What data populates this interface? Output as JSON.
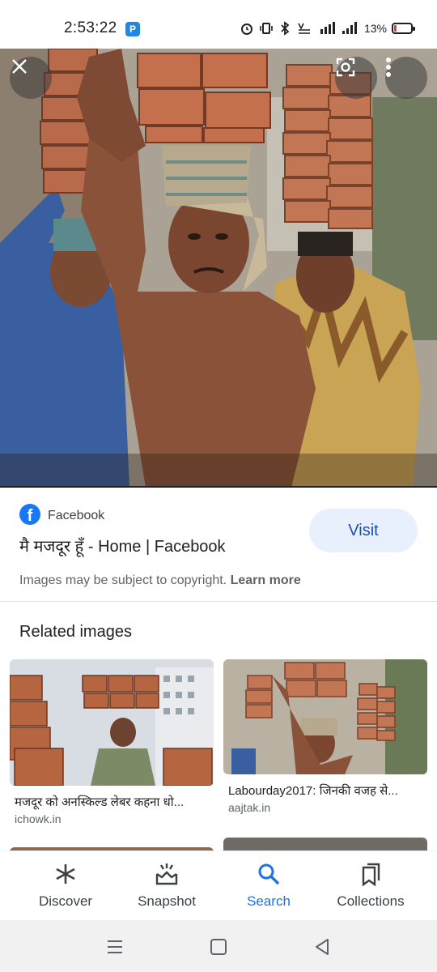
{
  "status_bar": {
    "time": "2:53:22",
    "app_badge": "P",
    "battery_percent_text": "13%",
    "battery_level": 0.13,
    "battery_color": "#e53935"
  },
  "hero": {
    "close_icon": "close-icon",
    "lens_icon": "google-lens-icon",
    "more_icon": "more-vert-icon"
  },
  "source": {
    "site_icon": "facebook-icon",
    "site_name": "Facebook",
    "title": "मै मजदूर हूँ - Home | Facebook",
    "visit_label": "Visit",
    "copyright_text": "Images may be subject to copyright.",
    "learn_more": "Learn more"
  },
  "related": {
    "heading": "Related images",
    "items": [
      {
        "caption": "मजदूर को अनस्किल्ड लेबर कहना धो...",
        "source": "ichowk.in"
      },
      {
        "caption": "Labourday2017: जिनकी वजह से...",
        "source": "aajtak.in"
      }
    ]
  },
  "bottom_nav": {
    "items": [
      {
        "label": "Discover",
        "icon": "asterisk-icon"
      },
      {
        "label": "Snapshot",
        "icon": "snapshot-icon"
      },
      {
        "label": "Search",
        "icon": "search-icon"
      },
      {
        "label": "Collections",
        "icon": "bookmarks-icon"
      }
    ],
    "active_color": "#1a73e8"
  },
  "system_nav": {
    "buttons": [
      "menu-icon",
      "home-icon",
      "back-icon"
    ]
  }
}
